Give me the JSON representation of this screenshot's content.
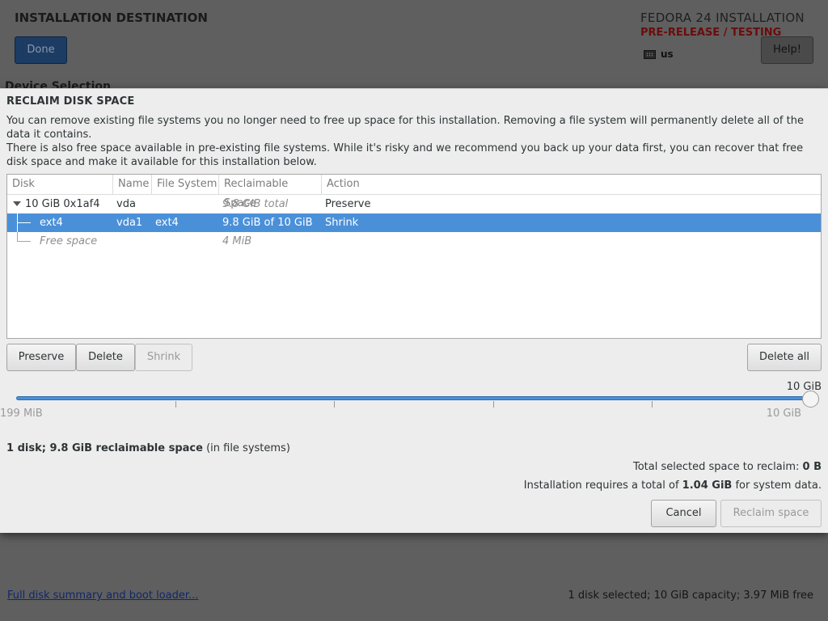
{
  "background": {
    "title": "INSTALLATION DESTINATION",
    "done_label": "Done",
    "product": "FEDORA 24 INSTALLATION",
    "prerelease": "PRE-RELEASE / TESTING",
    "keyboard_layout": "us",
    "help_label": "Help!",
    "device_selection": "Device Selection",
    "footer_link": "Full disk summary and boot loader...",
    "footer_status": "1 disk selected; 10 GiB capacity; 3.97 MiB free"
  },
  "dialog": {
    "title": "RECLAIM DISK SPACE",
    "text1": "You can remove existing file systems you no longer need to free up space for this installation.  Removing a file system will permanently delete all of the data it contains.",
    "text2": "There is also free space available in pre-existing file systems.  While it's risky and we recommend you back up your data first, you can recover that free disk space and make it available for this installation below.",
    "columns": [
      "Disk",
      "Name",
      "File System",
      "Reclaimable Space",
      "Action"
    ],
    "rows": [
      {
        "disk": "10 GiB 0x1af4",
        "name": "vda",
        "fs": "",
        "space": "9.8 GiB total",
        "action": "Preserve"
      },
      {
        "disk": "ext4",
        "name": "vda1",
        "fs": "ext4",
        "space": "9.8 GiB of 10 GiB",
        "action": "Shrink"
      },
      {
        "disk": "Free space",
        "name": "",
        "fs": "",
        "space": "4 MiB",
        "action": ""
      }
    ],
    "buttons": {
      "preserve": "Preserve",
      "delete": "Delete",
      "shrink": "Shrink",
      "delete_all": "Delete all",
      "cancel": "Cancel",
      "reclaim": "Reclaim space"
    },
    "slider": {
      "current_value": "10 GiB",
      "min_label": "199 MiB",
      "max_label": "10 GiB",
      "level": 1.0
    },
    "summary": {
      "bold": "1 disk; 9.8 GiB reclaimable space",
      "rest": " (in file systems)"
    },
    "total": {
      "label": "Total selected space to reclaim: ",
      "value": "0 B"
    },
    "requirement": {
      "prefix": "Installation requires a total of ",
      "value": "1.04 GiB",
      "suffix": " for system data."
    }
  },
  "colors": {
    "selection": "#4a90d9",
    "prerelease": "#6b0c0c",
    "done_button": "#1d3c64"
  }
}
